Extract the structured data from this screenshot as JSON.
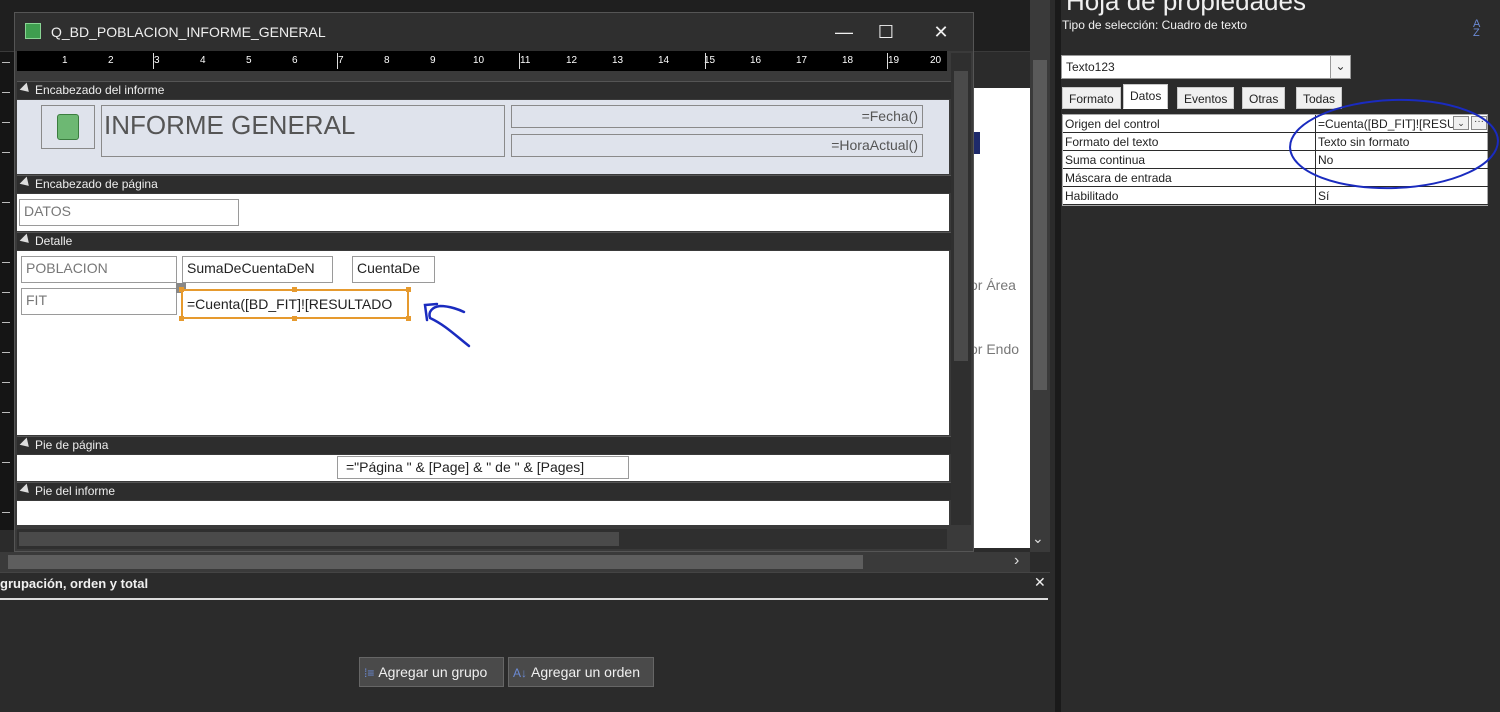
{
  "window": {
    "title": "Q_BD_POBLACION_INFORME_GENERAL",
    "minimize": "—",
    "maximize": "☐",
    "close": "✕"
  },
  "ruler": [
    "1",
    "2",
    "3",
    "4",
    "5",
    "6",
    "7",
    "8",
    "9",
    "10",
    "11",
    "12",
    "13",
    "14",
    "15",
    "16",
    "17",
    "18",
    "19",
    "20"
  ],
  "sections": {
    "report_header": "Encabezado del informe",
    "page_header": "Encabezado de página",
    "detail": "Detalle",
    "page_footer": "Pie de página",
    "report_footer": "Pie del informe"
  },
  "report": {
    "title": "INFORME GENERAL",
    "date_expr": "=Fecha()",
    "time_expr": "=HoraActual()",
    "page_header_label": "DATOS",
    "detail": {
      "poblacion_label": "POBLACION",
      "suma_field": "SumaDeCuentaDeN",
      "cuenta_field": "CuentaDe",
      "fit_label": "FIT",
      "selected_textbox": "=Cuenta([BD_FIT]![RESULTADO"
    },
    "page_footer_expr": "=\"Página \" & [Page] & \" de \" & [Pages]"
  },
  "background": {
    "report_fragment_1": "or Área",
    "report_fragment_2": "or Endo",
    "hscroll_arrow": "›",
    "vscroll_arrow": "⌄"
  },
  "property_sheet": {
    "title": "Hoja de propiedades",
    "selection_type": "Tipo de selección:  Cuadro de texto",
    "selected_object": "Texto123",
    "tabs": [
      "Formato",
      "Datos",
      "Eventos",
      "Otras",
      "Todas"
    ],
    "active_tab": "Datos",
    "rows": [
      {
        "name": "Origen del control",
        "value": "=Cuenta([BD_FIT]![RESU"
      },
      {
        "name": "Formato del texto",
        "value": "Texto sin formato"
      },
      {
        "name": "Suma continua",
        "value": "No"
      },
      {
        "name": "Máscara de entrada",
        "value": ""
      },
      {
        "name": "Habilitado",
        "value": "Sí"
      }
    ]
  },
  "grouping": {
    "title": "grupación, orden y total",
    "close": "✕",
    "add_group": "Agregar un grupo",
    "add_sort": "Agregar un orden"
  },
  "colors": {
    "accent_selection": "#e69a2e",
    "annotation_ink": "#1a2bbf",
    "report_header_bg": "#dfe3ec"
  }
}
